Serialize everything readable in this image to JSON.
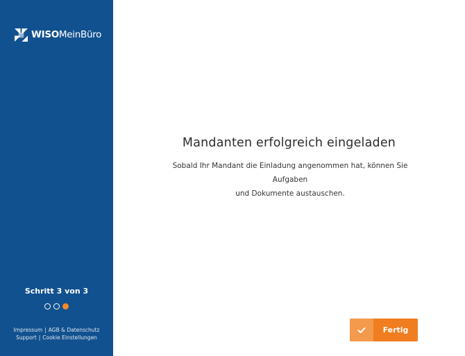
{
  "colors": {
    "sidebar_bg": "#12518f",
    "accent": "#f07d1f",
    "accent_light": "#f39a4d"
  },
  "sidebar": {
    "logo": {
      "icon": "wiso-logo-icon",
      "brand_bold": "WISO",
      "brand_rest": "MeinBüro"
    },
    "step_text": "Schritt 3 von 3",
    "progress": {
      "total": 3,
      "current": 3
    },
    "footer_links": {
      "impressum": "Impressum",
      "sep1": "|",
      "agb": "AGB & Datenschutz",
      "support": "Support",
      "sep2": "|",
      "cookie": "Cookie Einstellungen"
    }
  },
  "main": {
    "title": "Mandanten erfolgreich eingeladen",
    "description_line1": "Sobald Ihr Mandant die Einladung angenommen hat, können Sie Aufgaben",
    "description_line2": "und Dokumente austauschen.",
    "done_button": {
      "icon": "checkmark-icon",
      "label": "Fertig"
    }
  }
}
